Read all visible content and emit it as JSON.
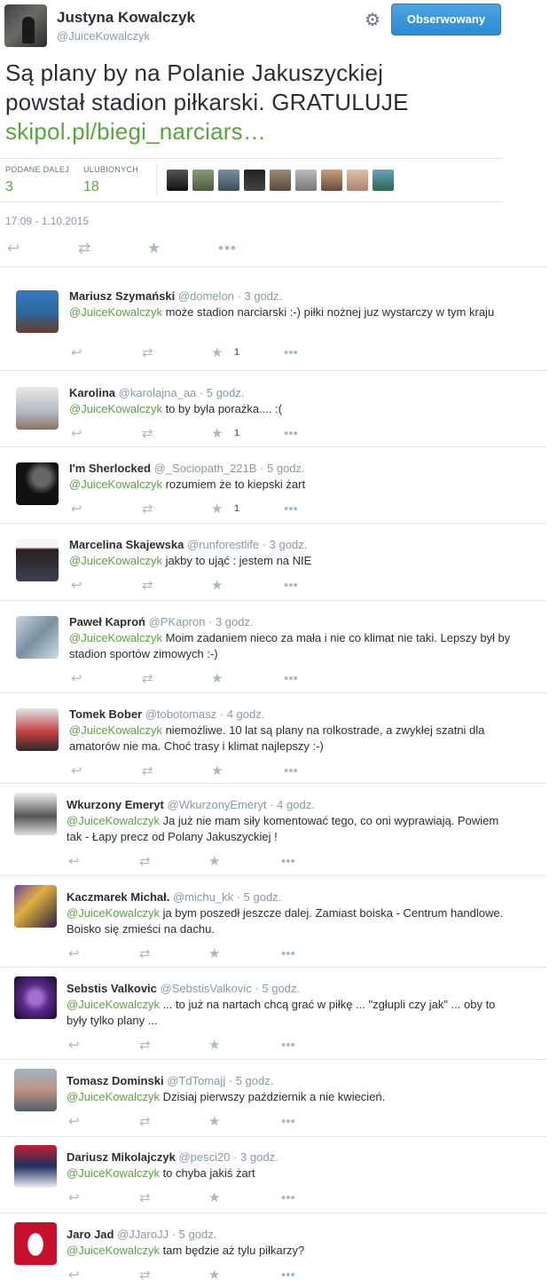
{
  "author": {
    "name": "Justyna Kowalczyk",
    "handle": "@JuiceKowalczyk",
    "follow_label": "Obserwowany"
  },
  "tweet": {
    "line1": "Są plany by na Polanie Jakuszyckiej",
    "line2": "powstał stadion piłkarski. GRATULUJE",
    "link": "skipol.pl/biegi_narciars…",
    "retweets_label": "PODANE DALEJ",
    "retweets": "3",
    "favorites_label": "ULUBIONYCH",
    "favorites": "18",
    "timestamp": "17:09 - 1.10.2015"
  },
  "icons": {
    "reply": "reply-icon",
    "retweet": "retweet-icon",
    "favorite": "star-icon",
    "more": "more-icon",
    "settings": "gear-icon"
  },
  "colors": {
    "link": "#58a540",
    "follow": "#2a8bd4",
    "muted": "#8899a6"
  },
  "replies": [
    {
      "name": "Mariusz Szymański",
      "handle": "@domelon",
      "time": "· 3 godz.",
      "mention": "@JuiceKowalczyk",
      "text": " może stadion narciarski :-) piłki nożnej juz wystarczy w tym kraju",
      "favorites": "1"
    },
    {
      "name": "Karolina",
      "handle": "@karolajna_aa",
      "time": "· 5 godz.",
      "mention": "@JuiceKowalczyk",
      "text": " to by byla porażka.... :(",
      "favorites": "1"
    },
    {
      "name": "I'm Sherlocked",
      "handle": "@_Sociopath_221B",
      "time": "· 5 godz.",
      "mention": "@JuiceKowalczyk",
      "text": " rozumiem że to kiepski żart",
      "favorites": "1"
    },
    {
      "name": "Marcelina Skajewska",
      "handle": "@runforestlife",
      "time": "· 3 godz.",
      "mention": "@JuiceKowalczyk",
      "text": " jakby to ująć : jestem na NIE",
      "favorites": ""
    },
    {
      "name": "Paweł Kaproń",
      "handle": "@PKapron",
      "time": "· 3 godz.",
      "mention": "@JuiceKowalczyk",
      "text": " Moim zadaniem nieco za mała i nie co klimat nie taki. Lepszy był by stadion sportów zimowych :-)",
      "favorites": ""
    },
    {
      "name": "Tomek Bober",
      "handle": "@tobotomasz",
      "time": "· 4 godz.",
      "mention": "@JuiceKowalczyk",
      "text": " niemożliwe. 10 lat są plany na rolkostrade, a zwykłej szatni dla amatorów nie ma. Choć trasy i klimat najlepszy :-)",
      "favorites": ""
    },
    {
      "name": "Wkurzony Emeryt",
      "handle": "@WkurzonyEmeryt",
      "time": "· 4 godz.",
      "mention": "@JuiceKowalczyk",
      "text": " Ja już nie mam siły komentować tego, co oni wyprawiają. Powiem tak - Łapy precz od Polany Jakuszyckiej !",
      "favorites": ""
    },
    {
      "name": "Kaczmarek Michał.",
      "handle": "@michu_kk",
      "time": "· 5 godz.",
      "mention": "@JuiceKowalczyk",
      "text": " ja bym poszedł jeszcze dalej. Zamiast boiska - Centrum handlowe. Boisko się zmieści na dachu.",
      "favorites": ""
    },
    {
      "name": "Sebstis Valkovic",
      "handle": "@SebstisValkovic",
      "time": "· 5 godz.",
      "mention": "@JuiceKowalczyk",
      "text": " ... to już na nartach chcą grać w piłkę ... \"zgłupli czy jak\" ... oby to były tylko plany ...",
      "favorites": ""
    },
    {
      "name": "Tomasz Dominski",
      "handle": "@TdTomajj",
      "time": "· 5 godz.",
      "mention": "@JuiceKowalczyk",
      "text": " Dzisiaj pierwszy październik a nie kwiecień.",
      "favorites": ""
    },
    {
      "name": "Dariusz Mikolajczyk",
      "handle": "@pesci20",
      "time": "· 3 godz.",
      "mention": "@JuiceKowalczyk",
      "text": " to chyba jakiś żart",
      "favorites": ""
    },
    {
      "name": "Jaro Jad",
      "handle": "@JJaroJJ",
      "time": "· 5 godz.",
      "mention": "@JuiceKowalczyk",
      "text": " tam będzie aż tylu piłkarzy?",
      "favorites": ""
    }
  ]
}
